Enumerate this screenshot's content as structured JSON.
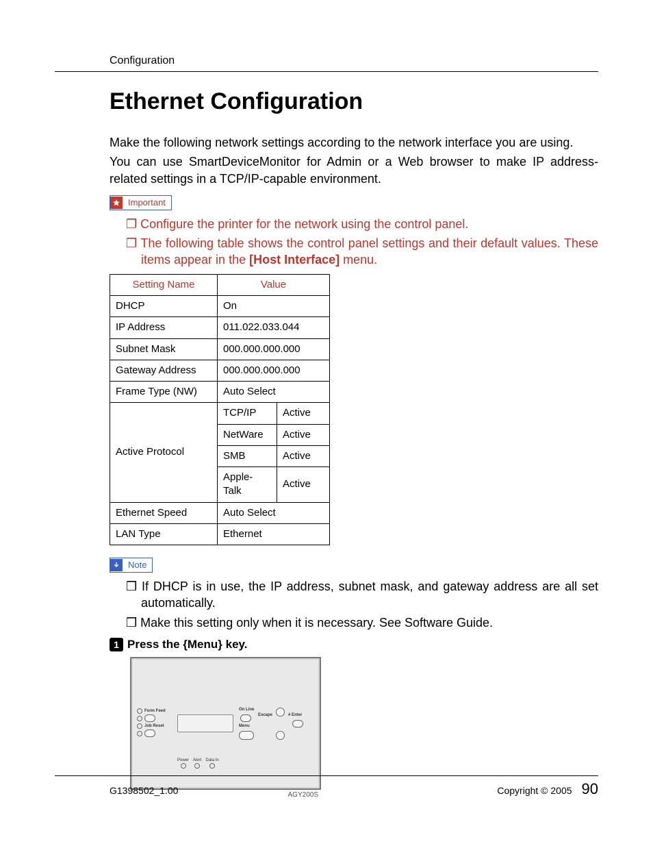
{
  "header": {
    "running_head": "Configuration"
  },
  "title": "Ethernet Configuration",
  "intro": {
    "p1": "Make the following network settings according to the network interface you are using.",
    "p2": "You can use SmartDeviceMonitor for Admin or a Web browser to make IP address-related settings in a TCP/IP-capable environment."
  },
  "important": {
    "label": "Important",
    "items": [
      "Configure the printer for the network using the control panel.",
      "The following table shows the control panel settings and their default values. These items appear in the [Host Interface] menu."
    ],
    "bold_fragment": "[Host Interface]"
  },
  "table": {
    "headers": {
      "name": "Setting Name",
      "value": "Value"
    },
    "rows_simple": [
      {
        "name": "DHCP",
        "value": "On"
      },
      {
        "name": "IP Address",
        "value": "011.022.033.044"
      },
      {
        "name": "Subnet Mask",
        "value": "000.000.000.000"
      },
      {
        "name": "Gateway Address",
        "value": "000.000.000.000"
      },
      {
        "name": "Frame Type (NW)",
        "value": "Auto Select"
      }
    ],
    "active_protocol_label": "Active Protocol",
    "active_protocols": [
      {
        "proto": "TCP/IP",
        "state": "Active"
      },
      {
        "proto": "NetWare",
        "state": "Active"
      },
      {
        "proto": "SMB",
        "state": "Active"
      },
      {
        "proto": "Apple-Talk",
        "state": "Active"
      }
    ],
    "rows_after": [
      {
        "name": "Ethernet Speed",
        "value": "Auto Select"
      },
      {
        "name": "LAN Type",
        "value": "Ethernet"
      }
    ]
  },
  "note": {
    "label": "Note",
    "items": [
      "If DHCP is in use, the IP address, subnet mask, and gateway address are all set automatically.",
      "Make this setting only when it is necessary. See Software Guide."
    ]
  },
  "step": {
    "number": "1",
    "prefix": "Press the ",
    "key_open": "{",
    "key_label": "Menu",
    "key_close": "}",
    "suffix": " key."
  },
  "panel": {
    "form_feed": "Form Feed",
    "job_reset": "Job Reset",
    "power": "Power",
    "alert": "Alert",
    "data_in": "Data In",
    "online": "On Line",
    "escape": "Escape",
    "enter": "# Enter",
    "menu": "Menu",
    "caption": "AGY200S"
  },
  "footer": {
    "doc_id": "G1398502_1.00",
    "copyright": "Copyright © 2005",
    "page": "90"
  }
}
